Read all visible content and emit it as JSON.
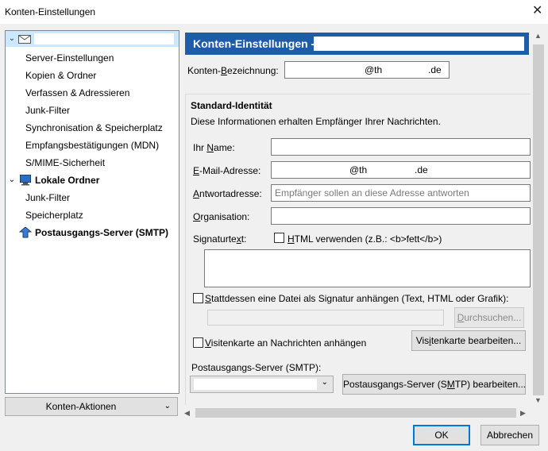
{
  "window": {
    "title": "Konten-Einstellungen"
  },
  "tree": {
    "items": [
      {
        "label": "Server-Einstellungen"
      },
      {
        "label": "Kopien & Ordner"
      },
      {
        "label": "Verfassen & Adressieren"
      },
      {
        "label": "Junk-Filter"
      },
      {
        "label": "Synchronisation & Speicherplatz"
      },
      {
        "label": "Empfangsbestätigungen (MDN)"
      },
      {
        "label": "S/MIME-Sicherheit"
      },
      {
        "label": "Lokale Ordner"
      },
      {
        "label": "Junk-Filter"
      },
      {
        "label": "Speicherplatz"
      },
      {
        "label": "Postausgangs-Server (SMTP)"
      }
    ],
    "actions_label": "Konten-Aktionen"
  },
  "main": {
    "header_title": "Konten-Einstellungen -",
    "account_name": {
      "label_pre": "Konten-",
      "label_u": "B",
      "label_post": "ezeichnung:",
      "value_at": "@th",
      "value_domain": ".de"
    },
    "identity": {
      "title": "Standard-Identität",
      "description": "Diese Informationen erhalten Empfänger Ihrer Nachrichten.",
      "name_label": {
        "pre": "Ihr ",
        "u": "N",
        "post": "ame:"
      },
      "email_label": {
        "pre": "",
        "u": "E",
        "post": "-Mail-Adresse:"
      },
      "email_at": "@th",
      "email_domain": ".de",
      "reply_label": {
        "pre": "",
        "u": "A",
        "post": "ntwortadresse:"
      },
      "reply_placeholder": "Empfänger sollen an diese Adresse antworten",
      "org_label": {
        "pre": "",
        "u": "O",
        "post": "rganisation:"
      },
      "signature_label": {
        "pre": "Signaturte",
        "u": "x",
        "post": "t:"
      },
      "html_check": {
        "pre": "",
        "u": "H",
        "post": "TML verwenden (z.B.: <b>fett</b>)"
      },
      "file_check": {
        "pre": "",
        "u": "S",
        "post": "tattdessen eine Datei als Signatur anhängen (Text, HTML oder Grafik):"
      },
      "browse_button": {
        "pre": "",
        "u": "D",
        "post": "urchsuchen..."
      },
      "vcard_check": {
        "pre": "",
        "u": "V",
        "post": "isitenkarte an Nachrichten anhängen"
      },
      "vcard_button": {
        "pre": "Vis",
        "u": "i",
        "post": "tenkarte bearbeiten..."
      },
      "smtp_label": {
        "pre": "Postausgangs-Server (SMTP):",
        "u": "",
        "post": ""
      },
      "smtp_button": {
        "pre": "Postausgangs-Server (S",
        "u": "M",
        "post": "TP) bearbeiten..."
      }
    }
  },
  "footer": {
    "ok": "OK",
    "cancel": "Abbrechen"
  },
  "colors": {
    "header_bg": "#1c5ca8",
    "selection": "#cce8ff",
    "default_border": "#0078d7"
  }
}
